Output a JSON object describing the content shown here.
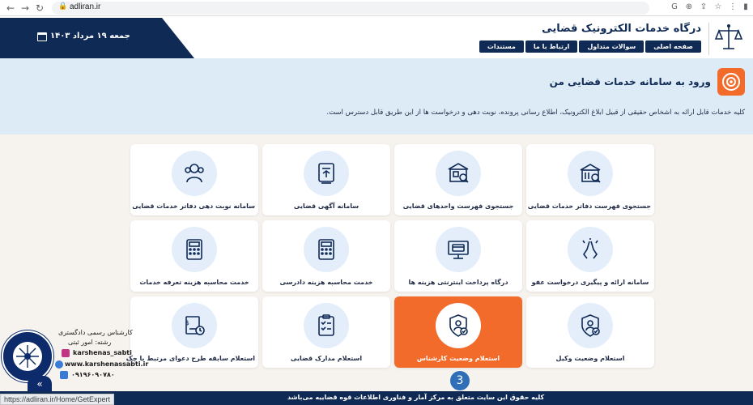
{
  "browser": {
    "url": "adliran.ir",
    "back_icon": "arrow-left-icon",
    "forward_icon": "arrow-right-icon",
    "reload_icon": "reload-icon"
  },
  "header": {
    "site_title": "درگاه خدمات الکترونیک قضایی",
    "date": "جمعه ۱۹ مرداد ۱۴۰۳",
    "menu": [
      {
        "label": "صفحه اصلی"
      },
      {
        "label": "سوالات متداول"
      },
      {
        "label": "ارتباط با ما"
      },
      {
        "label": "مستندات"
      }
    ],
    "colors": {
      "navy": "#102a56",
      "accent": "#f26b2a"
    }
  },
  "banner": {
    "title": "ورود به سامانه خدمات قضایی من",
    "description": "کلیه خدمات قابل ارائه به اشخاص حقیقی از قبیل ابلاغ الکترونیک، اطلاع رسانی پرونده، نوبت دهی و درخواست ها از این طریق قابل دسترس است."
  },
  "services": [
    {
      "label": "جستجوی فهرست دفاتر خدمات قضایی",
      "icon": "office-search-icon"
    },
    {
      "label": "جستجوی فهرست واحدهای قضایی",
      "icon": "court-search-icon"
    },
    {
      "label": "سامانه آگهی قضایی",
      "icon": "announcement-icon"
    },
    {
      "label": "سامانه نوبت دهی دفاتر خدمات قضایی",
      "icon": "people-appointment-icon"
    },
    {
      "label": "سامانه ارائه و پیگیری درخواست عفو",
      "icon": "pray-hands-icon"
    },
    {
      "label": "درگاه پرداخت اینترنتی هزینه ها",
      "icon": "payment-monitor-icon"
    },
    {
      "label": "خدمت محاسبه هزینه دادرسی",
      "icon": "calculator-icon"
    },
    {
      "label": "خدمت محاسبه هزینه تعرفه خدمات",
      "icon": "calculator-icon"
    },
    {
      "label": "استعلام وضعیت وکیل",
      "icon": "shield-user-icon"
    },
    {
      "label": "استعلام وضعیت کارشناس",
      "icon": "shield-expert-icon",
      "active": true
    },
    {
      "label": "استعلام مدارک قضایی",
      "icon": "clipboard-check-icon"
    },
    {
      "label": "استعلام سابقه طرح دعوای مرتبط با چک",
      "icon": "check-document-icon"
    }
  ],
  "step_badge": "3",
  "footer": {
    "text": "کلیه حقوق این سایت متعلق به مرکز آمار و فناوری اطلاعات قوه قضاییه می‌باشد"
  },
  "status_url": "https://adliran.ir/Home/GetExpert",
  "watermark": {
    "line1": "کارشناس رسمی دادگستری",
    "line2": "رشته: امور ثبتی",
    "instagram": "karshenas_sabti",
    "website": "www.karshenassabti.ir",
    "phone": "۰۹۱۹۶۰۹۰۷۸۰"
  }
}
